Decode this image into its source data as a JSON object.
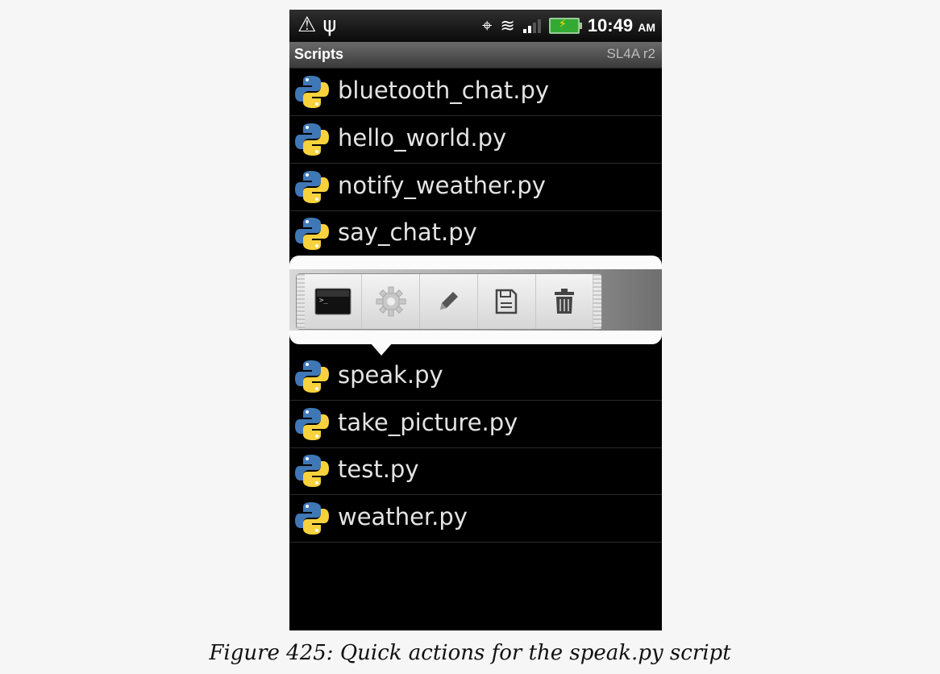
{
  "statusbar": {
    "time": "10:49",
    "ampm": "AM",
    "icons": [
      "alert-triangle-icon",
      "usb-icon",
      "gps-icon",
      "wifi-icon",
      "signal-bars-icon",
      "battery-charging-icon"
    ]
  },
  "titlebar": {
    "title": "Scripts",
    "subtitle": "SL4A r2"
  },
  "scripts": [
    "bluetooth_chat.py",
    "hello_world.py",
    "notify_weather.py",
    "say_chat.py",
    "speak.py",
    "take_picture.py",
    "test.py",
    "weather.py"
  ],
  "quick_actions": {
    "target_script": "speak.py",
    "buttons": [
      "terminal-icon",
      "gear-icon",
      "pencil-icon",
      "save-icon",
      "trash-icon"
    ]
  },
  "caption": "Figure 425: Quick actions for the speak.py script"
}
